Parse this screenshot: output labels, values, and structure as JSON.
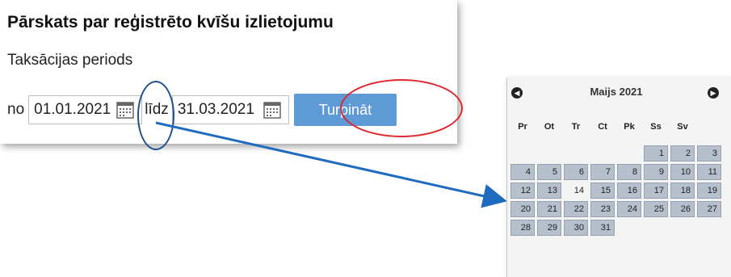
{
  "form": {
    "title": "Pārskats par reģistrēto kvīšu izlietojumu",
    "section_label": "Taksācijas periods",
    "from_label": "no",
    "from_value": "01.01.2021",
    "to_label": "līdz",
    "to_value": "31.03.2021",
    "submit_label": "Turpināt"
  },
  "calendar": {
    "month_label": "Maijs 2021",
    "weekdays": [
      "Pr",
      "Ot",
      "Tr",
      "Ct",
      "Pk",
      "Ss",
      "Sv"
    ],
    "leading_blanks": 5,
    "days_in_month": 31,
    "today": 14
  },
  "colors": {
    "button": "#5d9ad6",
    "highlight_blue": "#1f4e8c",
    "highlight_red": "#e0262e",
    "arrow": "#1e6bbf",
    "day_cell": "#b6c0cc"
  }
}
